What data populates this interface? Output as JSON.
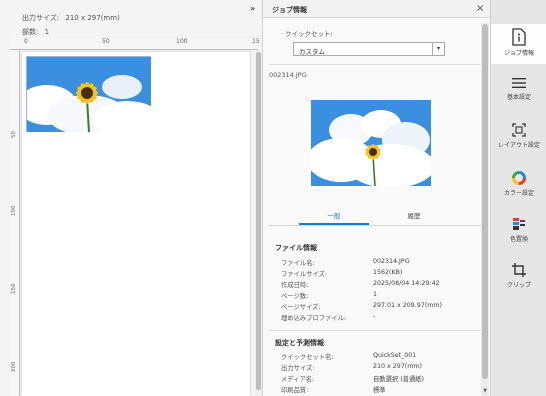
{
  "preview": {
    "size_label": "出力サイズ:",
    "size_value": "210 x 297(mm)",
    "copies_label": "部数:",
    "copies_value": "1",
    "ruler_h": [
      "0",
      "50",
      "100",
      "15"
    ],
    "ruler_v": [
      "50",
      "100",
      "150",
      "200"
    ]
  },
  "panel": {
    "title": "ジョブ情報",
    "quickset_label": "クイックセット:",
    "quickset_value": "カスタム",
    "filename": "002314.JPG",
    "tabs": [
      "一般",
      "履歴"
    ],
    "file_section": "ファイル情報",
    "file_rows": [
      {
        "k": "ファイル名:",
        "v": "002314.JPG"
      },
      {
        "k": "ファイルサイズ:",
        "v": "1562(KB)"
      },
      {
        "k": "作成日時:",
        "v": "2025/08/04 14:29:42"
      },
      {
        "k": "ページ数:",
        "v": "1"
      },
      {
        "k": "ページサイズ:",
        "v": "297.01 x 209.97(mm)"
      },
      {
        "k": "埋め込みプロファイル:",
        "v": "-"
      }
    ],
    "settings_section": "設定と予測情報",
    "settings_rows": [
      {
        "k": "クイックセット名:",
        "v": "QuickSet_001"
      },
      {
        "k": "出力サイズ:",
        "v": "210 x 297(mm)"
      },
      {
        "k": "メディア名:",
        "v": "自動選択 (普通紙)"
      },
      {
        "k": "印刷品質:",
        "v": "標準"
      }
    ]
  },
  "tools": [
    {
      "label": "ジョブ情報",
      "icon": "job-info-icon"
    },
    {
      "label": "基本設定",
      "icon": "basic-settings-icon"
    },
    {
      "label": "レイアウト設定",
      "icon": "layout-icon"
    },
    {
      "label": "カラー設定",
      "icon": "color-icon"
    },
    {
      "label": "色置換",
      "icon": "color-replace-icon"
    },
    {
      "label": "クリップ",
      "icon": "crop-icon"
    }
  ],
  "colors": {
    "accent": "#1b7bd1",
    "sky": "#3a8fe0"
  }
}
